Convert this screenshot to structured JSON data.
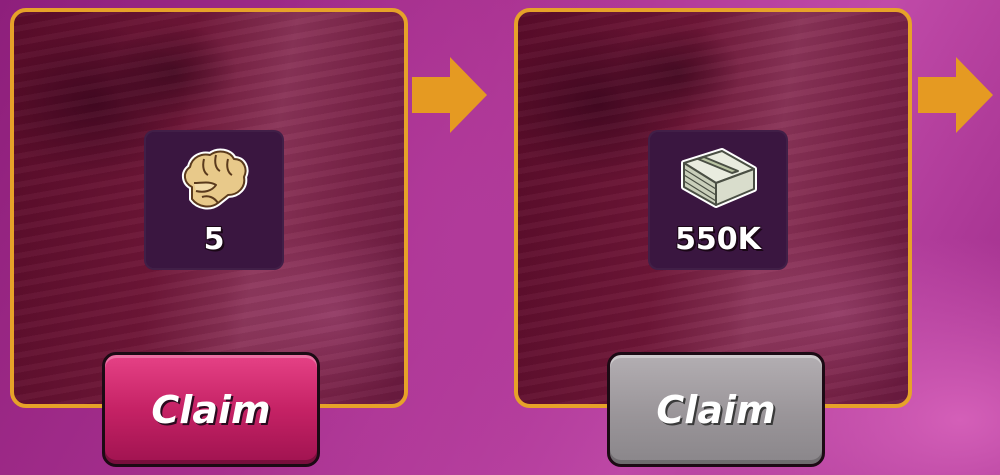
{
  "rewards": [
    {
      "icon": "fist-icon",
      "value": "5",
      "claim_label": "Claim",
      "claim_state": "active"
    },
    {
      "icon": "cash-stack-icon",
      "value": "550K",
      "claim_label": "Claim",
      "claim_state": "disabled"
    }
  ],
  "colors": {
    "frame": "#e6a229",
    "arrow": "#e59a22",
    "claim_active": "#c52265",
    "claim_disabled": "#9a9599"
  }
}
